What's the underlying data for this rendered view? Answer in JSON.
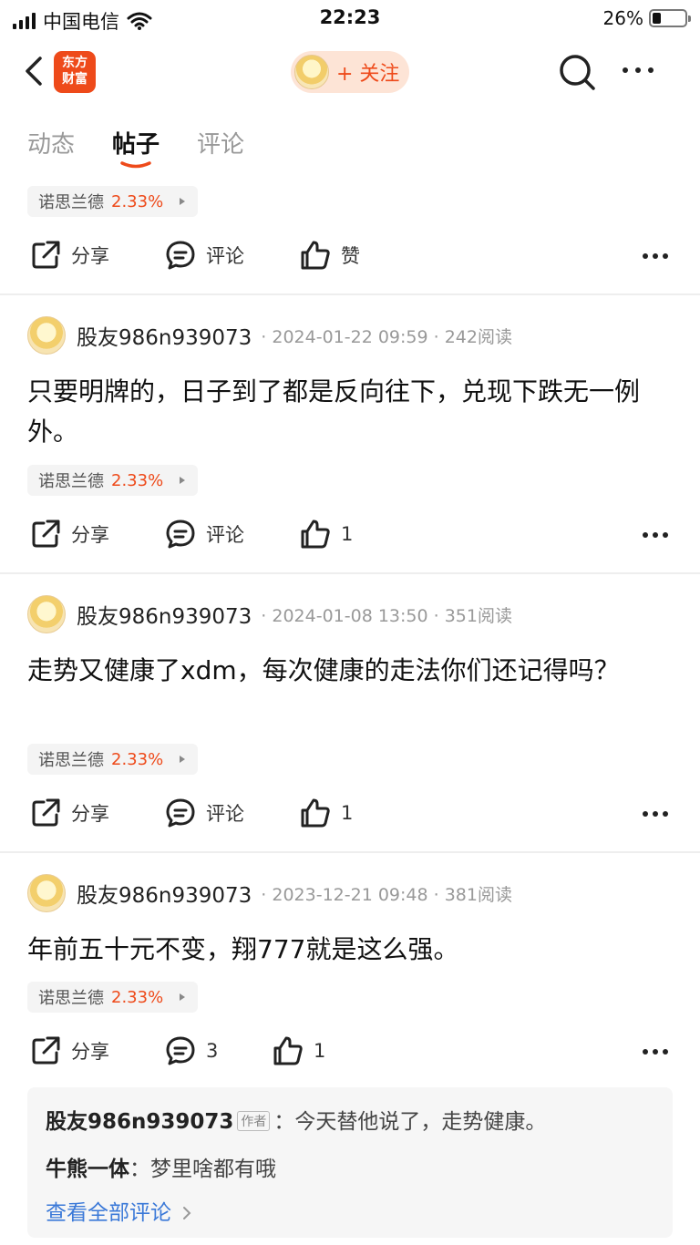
{
  "status_bar": {
    "carrier": "中国电信",
    "time": "22:23",
    "battery": "26%"
  },
  "nav": {
    "logo_line1": "东方",
    "logo_line2": "财富",
    "follow_label": "+ 关注"
  },
  "tabs": [
    {
      "label": "动态",
      "active": false
    },
    {
      "label": "帖子",
      "active": true
    },
    {
      "label": "评论",
      "active": false
    }
  ],
  "stock_chip": {
    "name": "诺思兰德",
    "change": "2.33%"
  },
  "actions": {
    "share": "分享",
    "comment": "评论",
    "like": "赞"
  },
  "posts": [
    {
      "author": "股友986n939073",
      "date": "2024-01-22 09:59",
      "reads": "242阅读",
      "content": "只要明牌的，日子到了都是反向往下，兑现下跌无一例外。",
      "comments": "评论",
      "likes": "1"
    },
    {
      "author": "股友986n939073",
      "date": "2024-01-08 13:50",
      "reads": "351阅读",
      "content": "走势又健康了xdm，每次健康的走法你们还记得吗？",
      "comments": "评论",
      "likes": "1"
    },
    {
      "author": "股友986n939073",
      "date": "2023-12-21 09:48",
      "reads": "381阅读",
      "content": "年前五十元不变，翔777就是这么强。",
      "comments": "3",
      "likes": "1"
    }
  ],
  "comment_preview": {
    "items": [
      {
        "user": "股友986n939073",
        "tag": "作者",
        "text": "今天替他说了，走势健康。"
      },
      {
        "user": "牛熊一体",
        "tag": "",
        "text": "梦里啥都有哦"
      }
    ],
    "view_all": "查看全部评论"
  },
  "colors": {
    "accent": "#ee4a1a",
    "link": "#3b79d8"
  }
}
